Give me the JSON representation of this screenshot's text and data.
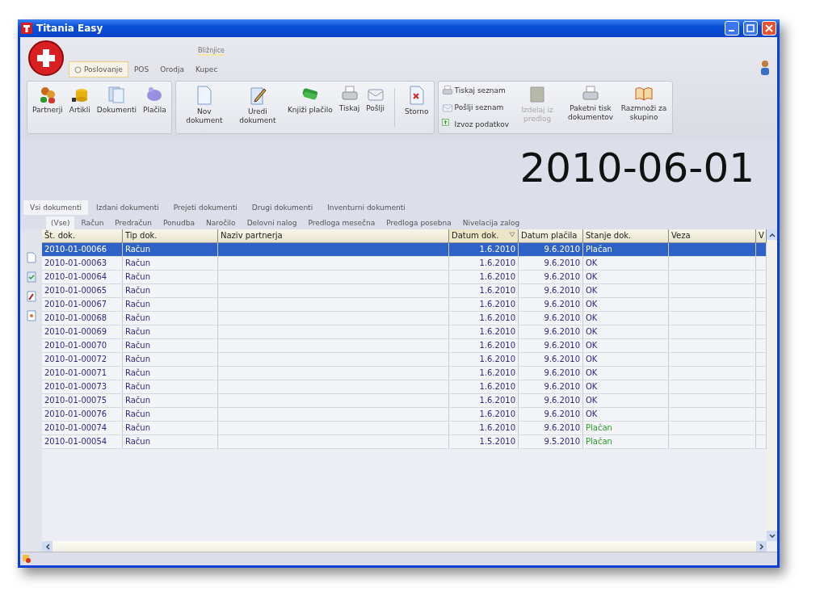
{
  "window": {
    "title": "Titania Easy"
  },
  "ribbon": {
    "shortcuts_label": "Bližnjice",
    "tabs": [
      {
        "label": "Poslovanje",
        "selected": true
      },
      {
        "label": "POS",
        "selected": false
      },
      {
        "label": "Orodja",
        "selected": false
      },
      {
        "label": "Kupec",
        "selected": false
      }
    ],
    "groups": [
      {
        "buttons": [
          {
            "kind": "large",
            "label": "Partnerji",
            "disabled": false
          },
          {
            "kind": "large",
            "label": "Artikli",
            "disabled": false
          },
          {
            "kind": "large",
            "label": "Dokumenti",
            "disabled": false
          },
          {
            "kind": "large",
            "label": "Plačila",
            "disabled": false
          }
        ]
      },
      {
        "buttons": [
          {
            "kind": "large",
            "label": "Nov dokument",
            "disabled": false
          },
          {
            "kind": "large",
            "label": "Uredi dokument",
            "disabled": false
          },
          {
            "kind": "large",
            "label": "Knjiži plačilo",
            "disabled": false
          },
          {
            "kind": "large",
            "label": "Tiskaj",
            "disabled": false
          },
          {
            "kind": "large",
            "label": "Pošlji",
            "disabled": false
          },
          {
            "kind": "separator"
          },
          {
            "kind": "large",
            "label": "Storno",
            "disabled": false
          }
        ]
      },
      {
        "buttons": [
          {
            "kind": "stack",
            "items": [
              {
                "label": "Tiskaj seznam"
              },
              {
                "label": "Pošlji seznam"
              },
              {
                "label": "Izvoz podatkov"
              }
            ]
          },
          {
            "kind": "large",
            "label": "Izdelaj iz predlog",
            "disabled": true
          },
          {
            "kind": "large",
            "label": "Paketni tisk dokumentov",
            "disabled": false
          },
          {
            "kind": "large",
            "label": "Razmnoži za skupino",
            "disabled": false
          }
        ]
      }
    ]
  },
  "date": "2010-06-01",
  "doc_tabs": [
    {
      "label": "Vsi dokumenti",
      "selected": true
    },
    {
      "label": "Izdani dokumenti",
      "selected": false
    },
    {
      "label": "Prejeti dokumenti",
      "selected": false
    },
    {
      "label": "Drugi dokumenti",
      "selected": false
    },
    {
      "label": "Inventurni dokumenti",
      "selected": false
    }
  ],
  "type_tabs": [
    {
      "label": "(Vse)",
      "selected": true
    },
    {
      "label": "Račun",
      "selected": false
    },
    {
      "label": "Predračun",
      "selected": false
    },
    {
      "label": "Ponudba",
      "selected": false
    },
    {
      "label": "Naročilo",
      "selected": false
    },
    {
      "label": "Delovni nalog",
      "selected": false
    },
    {
      "label": "Predloga mesečna",
      "selected": false
    },
    {
      "label": "Predloga posebna",
      "selected": false
    },
    {
      "label": "Nivelacija zalog",
      "selected": false
    }
  ],
  "table": {
    "columns": [
      {
        "label": "Št. dok.",
        "sorted": false
      },
      {
        "label": "Tip dok.",
        "sorted": false
      },
      {
        "label": "Naziv partnerja",
        "sorted": false
      },
      {
        "label": "Datum dok.",
        "sorted": true
      },
      {
        "label": "Datum plačila",
        "sorted": false
      },
      {
        "label": "Stanje dok.",
        "sorted": false
      },
      {
        "label": "Veza",
        "sorted": false
      },
      {
        "label": "V",
        "sorted": false
      }
    ],
    "rows": [
      {
        "number": "2010-01-00066",
        "type": "Račun",
        "date": "1.6.2010",
        "due": "9.6.2010",
        "status": "Plačan",
        "paid": true,
        "selected": true
      },
      {
        "number": "2010-01-00063",
        "type": "Račun",
        "date": "1.6.2010",
        "due": "9.6.2010",
        "status": "OK",
        "paid": false,
        "selected": false
      },
      {
        "number": "2010-01-00064",
        "type": "Račun",
        "date": "1.6.2010",
        "due": "9.6.2010",
        "status": "OK",
        "paid": false,
        "selected": false
      },
      {
        "number": "2010-01-00065",
        "type": "Račun",
        "date": "1.6.2010",
        "due": "9.6.2010",
        "status": "OK",
        "paid": false,
        "selected": false
      },
      {
        "number": "2010-01-00067",
        "type": "Račun",
        "date": "1.6.2010",
        "due": "9.6.2010",
        "status": "OK",
        "paid": false,
        "selected": false
      },
      {
        "number": "2010-01-00068",
        "type": "Račun",
        "date": "1.6.2010",
        "due": "9.6.2010",
        "status": "OK",
        "paid": false,
        "selected": false
      },
      {
        "number": "2010-01-00069",
        "type": "Račun",
        "date": "1.6.2010",
        "due": "9.6.2010",
        "status": "OK",
        "paid": false,
        "selected": false
      },
      {
        "number": "2010-01-00070",
        "type": "Račun",
        "date": "1.6.2010",
        "due": "9.6.2010",
        "status": "OK",
        "paid": false,
        "selected": false
      },
      {
        "number": "2010-01-00072",
        "type": "Račun",
        "date": "1.6.2010",
        "due": "9.6.2010",
        "status": "OK",
        "paid": false,
        "selected": false
      },
      {
        "number": "2010-01-00071",
        "type": "Račun",
        "date": "1.6.2010",
        "due": "9.6.2010",
        "status": "OK",
        "paid": false,
        "selected": false
      },
      {
        "number": "2010-01-00073",
        "type": "Račun",
        "date": "1.6.2010",
        "due": "9.6.2010",
        "status": "OK",
        "paid": false,
        "selected": false
      },
      {
        "number": "2010-01-00075",
        "type": "Račun",
        "date": "1.6.2010",
        "due": "9.6.2010",
        "status": "OK",
        "paid": false,
        "selected": false
      },
      {
        "number": "2010-01-00076",
        "type": "Račun",
        "date": "1.6.2010",
        "due": "9.6.2010",
        "status": "OK",
        "paid": false,
        "selected": false
      },
      {
        "number": "2010-01-00074",
        "type": "Račun",
        "date": "1.6.2010",
        "due": "9.6.2010",
        "status": "Plačan",
        "paid": true,
        "selected": false
      },
      {
        "number": "2010-01-00054",
        "type": "Račun",
        "date": "1.5.2010",
        "due": "9.5.2010",
        "status": "Plačan",
        "paid": true,
        "selected": false
      }
    ]
  }
}
